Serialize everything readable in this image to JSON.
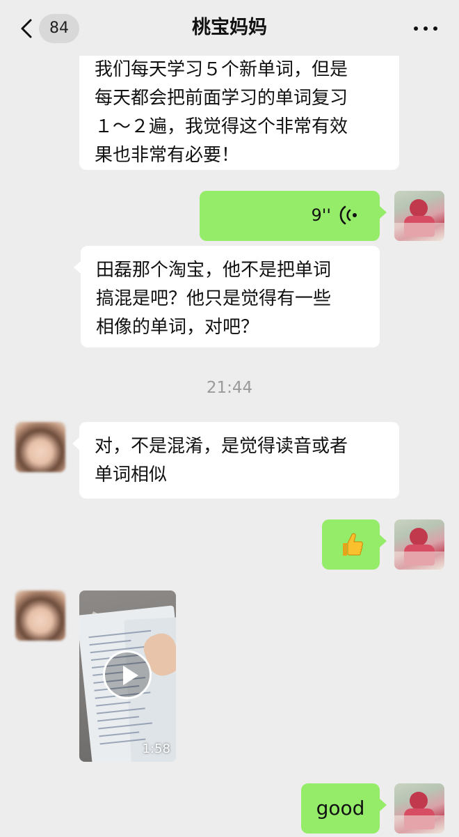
{
  "header": {
    "unread_count": "84",
    "title": "桃宝妈妈"
  },
  "messages": [
    {
      "side": "in",
      "lines": [
        "我们每天学习５个新单词，但是",
        "每天都会把前面学习的单词复习",
        "１～２遍，我觉得这个非常有效",
        "果也非常有必要！"
      ]
    },
    {
      "side": "out",
      "type": "voice",
      "duration": "9''"
    },
    {
      "side": "in",
      "lines": [
        "田磊那个淘宝，他不是把单词",
        "搞混是吧？他只是觉得有一些",
        "相像的单词，对吧？"
      ]
    },
    {
      "type": "time",
      "text": "21:44"
    },
    {
      "side": "in",
      "lines": [
        "对，不是混淆，是觉得读音或者",
        "单词相似"
      ]
    },
    {
      "side": "out",
      "type": "emoji",
      "emoji": "thumbs-up"
    },
    {
      "side": "in",
      "type": "video",
      "duration": "1:58"
    },
    {
      "side": "out",
      "text": "good"
    }
  ],
  "colors": {
    "background": "#ededed",
    "outgoing_bubble": "#95ec69",
    "incoming_bubble": "#ffffff",
    "timestamp": "#9a9a9a"
  }
}
